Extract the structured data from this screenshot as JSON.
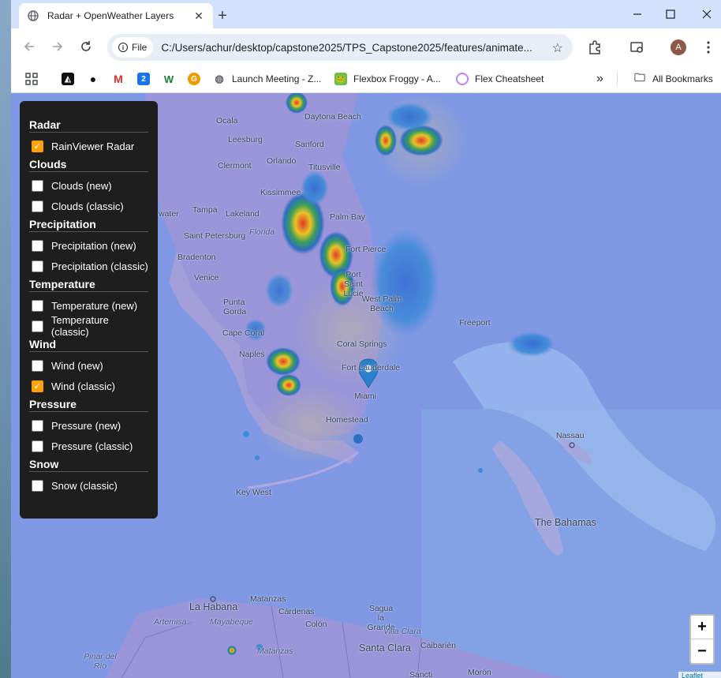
{
  "browser": {
    "tab_title": "Radar + OpenWeather Layers",
    "file_chip": "File",
    "url": "C:/Users/achur/desktop/capstone2025/TPS_Capstone2025/features/animate...",
    "avatar_letter": "A"
  },
  "bookmarks": {
    "items": [
      {
        "label": "Launch Meeting - Z...",
        "icon": "globe-icon"
      },
      {
        "label": "Flexbox Froggy - A...",
        "icon": "frog-icon"
      },
      {
        "label": "Flex Cheatsheet",
        "icon": "ring-icon"
      }
    ],
    "all_label": "All Bookmarks"
  },
  "panel": {
    "groups": [
      {
        "title": "Radar",
        "options": [
          {
            "label": "RainViewer Radar",
            "checked": true
          }
        ]
      },
      {
        "title": "Clouds",
        "options": [
          {
            "label": "Clouds (new)",
            "checked": false
          },
          {
            "label": "Clouds (classic)",
            "checked": false
          }
        ]
      },
      {
        "title": "Precipitation",
        "options": [
          {
            "label": "Precipitation (new)",
            "checked": false
          },
          {
            "label": "Precipitation (classic)",
            "checked": false
          }
        ]
      },
      {
        "title": "Temperature",
        "options": [
          {
            "label": "Temperature (new)",
            "checked": false
          },
          {
            "label": "Temperature (classic)",
            "checked": false
          }
        ]
      },
      {
        "title": "Wind",
        "options": [
          {
            "label": "Wind (new)",
            "checked": false
          },
          {
            "label": "Wind (classic)",
            "checked": true
          }
        ]
      },
      {
        "title": "Pressure",
        "options": [
          {
            "label": "Pressure (new)",
            "checked": false
          },
          {
            "label": "Pressure (classic)",
            "checked": false
          }
        ]
      },
      {
        "title": "Snow",
        "options": [
          {
            "label": "Snow (classic)",
            "checked": false
          }
        ]
      }
    ]
  },
  "map": {
    "places": {
      "daytona": "Daytona Beach",
      "ocala": "Ocala",
      "sanford": "Sanford",
      "leesburg": "Leesburg",
      "clermont": "Clermont",
      "orlando": "Orlando",
      "titusville": "Titusville",
      "kissimmee": "Kissimmee",
      "water": "water",
      "tampa": "Tampa",
      "lakeland": "Lakeland",
      "florida": "Florida",
      "palmbay": "Palm Bay",
      "stpete": "Saint Petersburg",
      "bradenton": "Bradenton",
      "fortpierce": "Fort Pierce",
      "venice": "Venice",
      "portstlucie": "Port Saint Lucie",
      "puntagorda": "Punta Gorda",
      "westpalm": "West Palm Beach",
      "freeport": "Freeport",
      "capecoral": "Cape Coral",
      "coralsprings": "Coral Springs",
      "naples": "Naples",
      "fortlauderdale": "Fort Lauderdale",
      "miami": "Miami",
      "homestead": "Homestead",
      "nassau": "Nassau",
      "keywest": "Key West",
      "bahamas": "The Bahamas",
      "matanzas": "Matanzas",
      "lahabana": "La Habana",
      "cardenas": "Cárdenas",
      "sagua": "Sagua la Grande",
      "artemisa": "Artemisa",
      "mayabeque": "Mayabeque",
      "colon": "Colón",
      "villaclara": "Villa Clara",
      "pinar": "Pinar del Río",
      "matanzas_prov": "Matanzas",
      "santaclara": "Santa Clara",
      "caibarien": "Caibarién",
      "sancti": "Sancti",
      "moron": "Morón"
    },
    "zoom_in": "+",
    "zoom_out": "−",
    "attribution": "Leaflet"
  }
}
